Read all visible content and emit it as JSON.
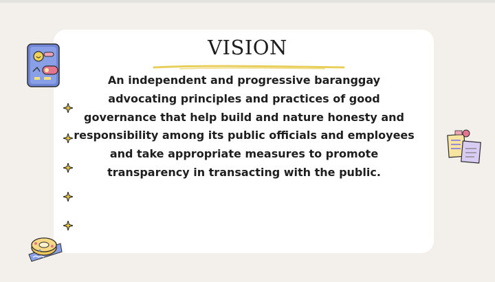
{
  "slide": {
    "title": "VISION",
    "body": "An independent and progressive baranggay advocating principles and practices of good governance that help build and nature honesty and responsibility among its public officials and employees and take appropriate measures to promote transparency in transacting with the public."
  },
  "colors": {
    "background": "#f3f0eb",
    "card": "#ffffff",
    "underline": "#e8cf5a",
    "sparkle": "#e9c93a"
  },
  "icons": [
    "notebook-sticker-icon",
    "sticky-notes-icon",
    "washi-tape-icon",
    "sparkle-icon"
  ]
}
